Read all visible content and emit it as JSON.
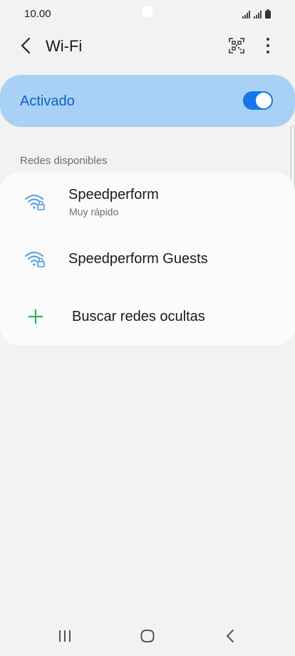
{
  "status_bar": {
    "time": "10.00"
  },
  "header": {
    "title": "Wi-Fi"
  },
  "master_switch": {
    "label": "Activado",
    "enabled": true
  },
  "available_networks": {
    "section_label": "Redes disponibles",
    "networks": [
      {
        "name": "Speedperform",
        "subtitle": "Muy rápido",
        "secured": true
      },
      {
        "name": "Speedperform Guests",
        "subtitle": "",
        "secured": true
      }
    ],
    "add_hidden_label": "Buscar redes ocultas"
  },
  "colors": {
    "accent": "#1677e8",
    "accent_text": "#0c63c4",
    "wifi_icon": "#4a9be6",
    "add_icon": "#2bb35a",
    "master_bg": "#a9d0f5"
  }
}
